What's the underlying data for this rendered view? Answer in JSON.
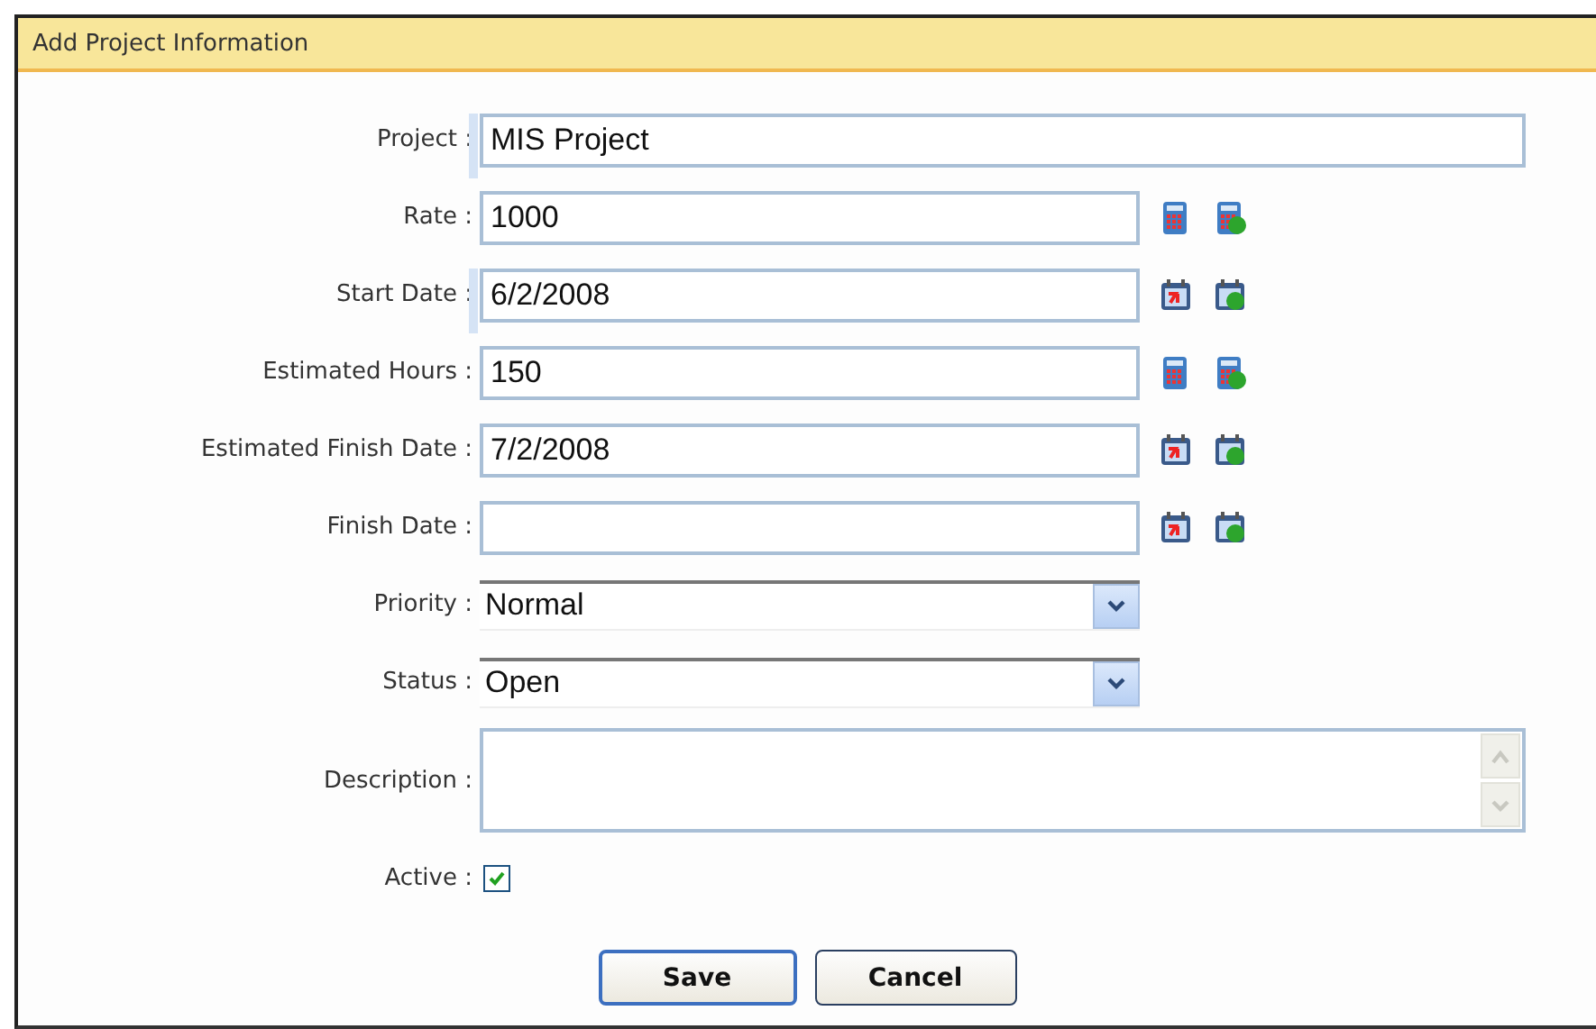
{
  "panel": {
    "title": "Add Project Information"
  },
  "fields": [
    {
      "kind": "text",
      "label": "Project :",
      "value": "MIS Project",
      "marked": true,
      "wide": true
    },
    {
      "kind": "calculator",
      "label": "Rate :",
      "value": "1000",
      "marked": false,
      "wide": false
    },
    {
      "kind": "calendar",
      "label": "Start Date :",
      "value": "6/2/2008",
      "marked": true,
      "wide": false
    },
    {
      "kind": "calculator",
      "label": "Estimated Hours :",
      "value": "150",
      "marked": false,
      "wide": false
    },
    {
      "kind": "calendar",
      "label": "Estimated Finish Date :",
      "value": "7/2/2008",
      "marked": false,
      "wide": false
    },
    {
      "kind": "calendar",
      "label": "Finish Date :",
      "marked": false,
      "wide": false
    },
    {
      "kind": "select",
      "label": "Priority :",
      "value": "Normal"
    },
    {
      "kind": "select",
      "label": "Status :",
      "value": "Open"
    },
    {
      "kind": "textarea",
      "label": "Description :"
    },
    {
      "kind": "checkbox",
      "label": "Active :",
      "checked": true
    }
  ],
  "buttons": [
    {
      "label": "Save",
      "selected": true
    },
    {
      "label": "Cancel",
      "selected": false
    }
  ]
}
